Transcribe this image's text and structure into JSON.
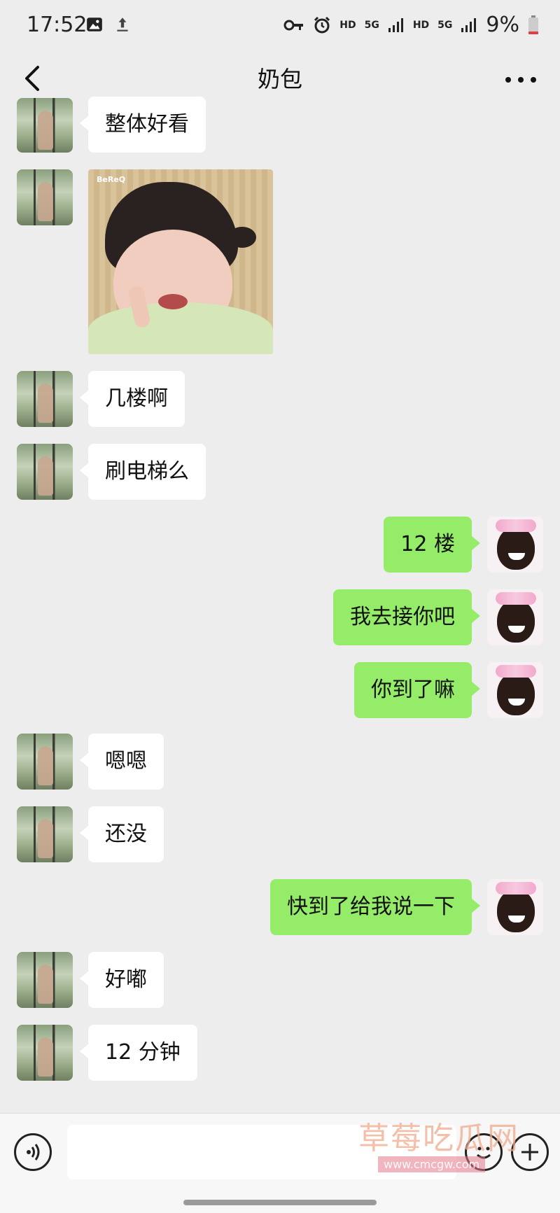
{
  "status_bar": {
    "time": "17:52",
    "hd_1": "HD",
    "net_1": "5G",
    "hd_2": "HD",
    "net_2": "5G",
    "battery": "9%"
  },
  "nav": {
    "title": "奶包"
  },
  "messages": [
    {
      "side": "other",
      "type": "text",
      "text": "整体好看"
    },
    {
      "side": "other",
      "type": "sticker",
      "sticker_tag": "BeReQ"
    },
    {
      "side": "other",
      "type": "text",
      "text": "几楼啊"
    },
    {
      "side": "other",
      "type": "text",
      "text": "刷电梯么"
    },
    {
      "side": "self",
      "type": "text",
      "text": "12 楼"
    },
    {
      "side": "self",
      "type": "text",
      "text": "我去接你吧"
    },
    {
      "side": "self",
      "type": "text",
      "text": "你到了嘛"
    },
    {
      "side": "other",
      "type": "text",
      "text": "嗯嗯"
    },
    {
      "side": "other",
      "type": "text",
      "text": "还没"
    },
    {
      "side": "self",
      "type": "text",
      "text": "快到了给我说一下"
    },
    {
      "side": "other",
      "type": "text",
      "text": "好嘟"
    },
    {
      "side": "other",
      "type": "text",
      "text": "12 分钟"
    }
  ],
  "input": {
    "value": "",
    "placeholder": ""
  },
  "watermark": {
    "text": "草莓吃瓜网",
    "url": "www.cmcgw.com"
  },
  "colors": {
    "background": "#ededed",
    "bubble_self": "#95ec69",
    "bubble_other": "#ffffff"
  }
}
